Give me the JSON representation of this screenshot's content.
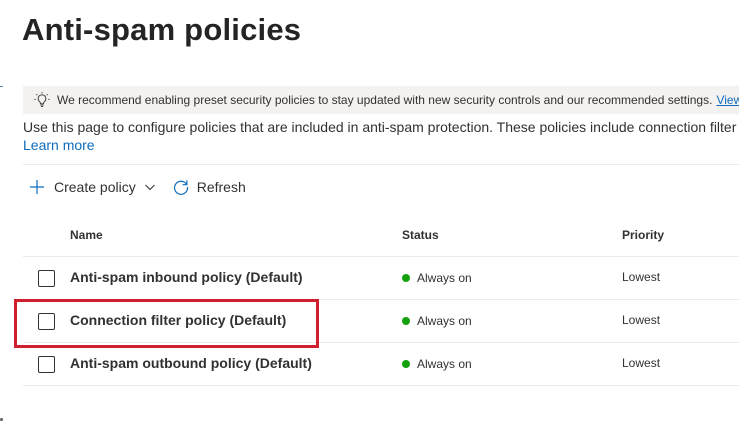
{
  "page": {
    "title": "Anti-spam policies"
  },
  "banner": {
    "icon": "lightbulb-icon",
    "text": "We recommend enabling preset security policies to stay updated with new security controls and our recommended settings.",
    "link_text": "View"
  },
  "description": {
    "text": "Use this page to configure policies that are included in anti-spam protection. These policies include connection filter",
    "learn_more": "Learn more"
  },
  "toolbar": {
    "create_label": "Create policy",
    "create_icon": "plus-icon",
    "dropdown_icon": "chevron-down-icon",
    "refresh_label": "Refresh",
    "refresh_icon": "refresh-icon"
  },
  "table": {
    "columns": [
      "Name",
      "Status",
      "Priority"
    ],
    "rows": [
      {
        "name": "Anti-spam inbound policy (Default)",
        "status": "Always on",
        "priority": "Lowest"
      },
      {
        "name": "Connection filter policy (Default)",
        "status": "Always on",
        "priority": "Lowest"
      },
      {
        "name": "Anti-spam outbound policy (Default)",
        "status": "Always on",
        "priority": "Lowest"
      }
    ]
  },
  "colors": {
    "accent": "#0f6cbd",
    "status_on": "#13a10e",
    "highlight": "#d0202f"
  }
}
